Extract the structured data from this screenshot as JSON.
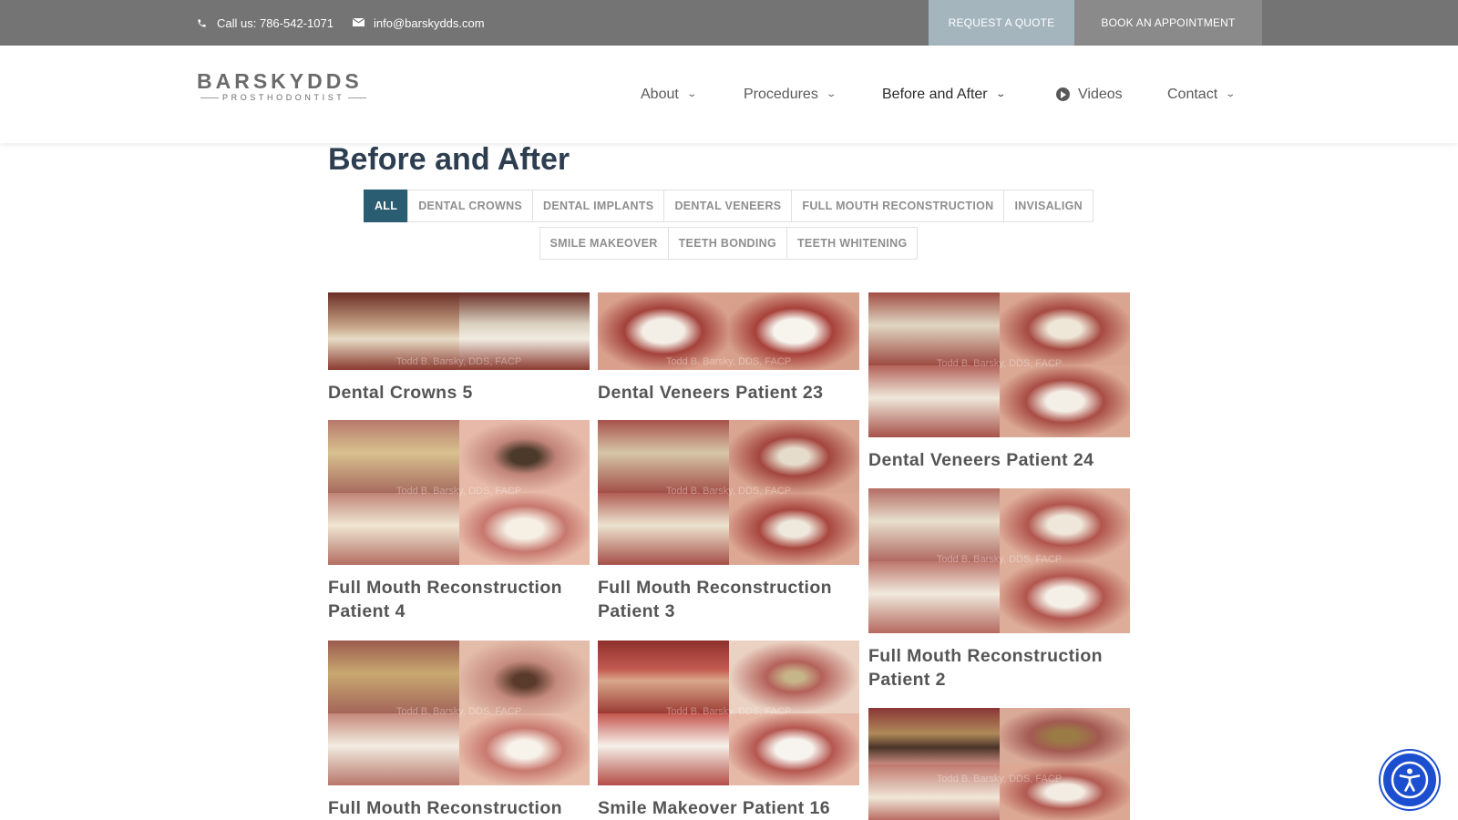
{
  "topbar": {
    "phone_text": "Call us: 786-542-1071",
    "email_text": "info@barskydds.com",
    "quote_label": "REQUEST A QUOTE",
    "appointment_label": "BOOK AN APPOINTMENT"
  },
  "logo": {
    "name": "BARSKYDDS",
    "tagline": "PROSTHODONTIST"
  },
  "nav": {
    "about": "About",
    "procedures": "Procedures",
    "before_after": "Before and After",
    "videos": "Videos",
    "contact": "Contact"
  },
  "page": {
    "title": "Before and After"
  },
  "filters": {
    "row1": [
      "ALL",
      "DENTAL CROWNS",
      "DENTAL IMPLANTS",
      "DENTAL VENEERS",
      "FULL MOUTH RECONSTRUCTION",
      "INVISALIGN"
    ],
    "row2": [
      "SMILE MAKEOVER",
      "TEETH BONDING",
      "TEETH WHITENING"
    ],
    "active": "ALL"
  },
  "gallery": {
    "watermark": "Todd B. Barsky, DDS, FACP",
    "items": [
      "Dental Crowns 5",
      "Dental Veneers Patient 23",
      "Dental Veneers Patient 24",
      "Full Mouth Reconstruction Patient 4",
      "Full Mouth Reconstruction Patient 3",
      "Full Mouth Reconstruction Patient 2",
      "Full Mouth Reconstruction",
      "Smile Makeover Patient 16"
    ]
  },
  "colors": {
    "topbar": "#747474",
    "quote_button": "#a4b5be",
    "active_filter": "#2b5d72",
    "title": "#2d3e50",
    "accessibility": "#1c4fd0"
  }
}
